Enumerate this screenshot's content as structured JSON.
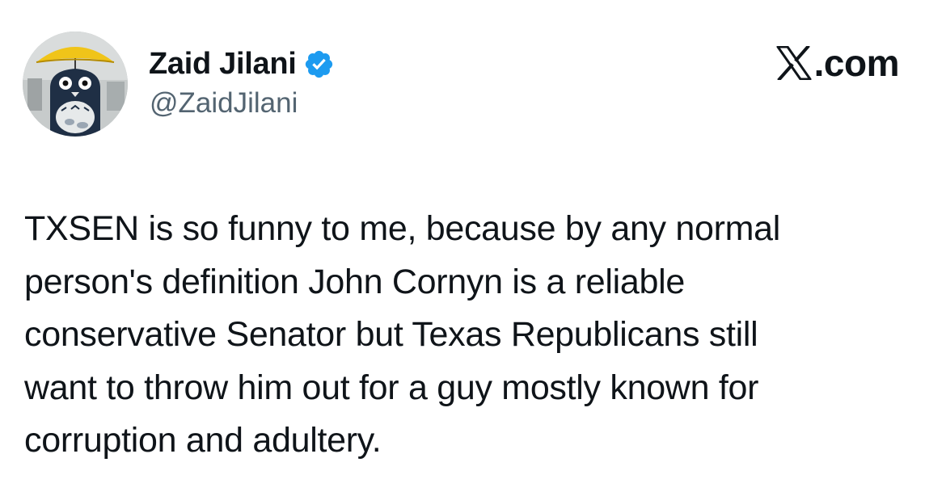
{
  "author": {
    "display_name": "Zaid Jilani",
    "handle": "@ZaidJilani",
    "verified_icon": "verified-badge-icon",
    "avatar_icon": "profile-avatar"
  },
  "brand": {
    "logo_icon": "x-logo-icon",
    "suffix": ".com"
  },
  "tweet": {
    "lines": [
      "TXSEN is so funny to me, because by any normal",
      "person's definition John Cornyn is a reliable",
      "conservative Senator but Texas Republicans still",
      "want to throw him out for a guy mostly known for",
      "corruption and adultery."
    ]
  },
  "colors": {
    "text_primary": "#0f1419",
    "text_secondary": "#536471",
    "verified_blue": "#1d9bf0",
    "background": "#ffffff"
  }
}
